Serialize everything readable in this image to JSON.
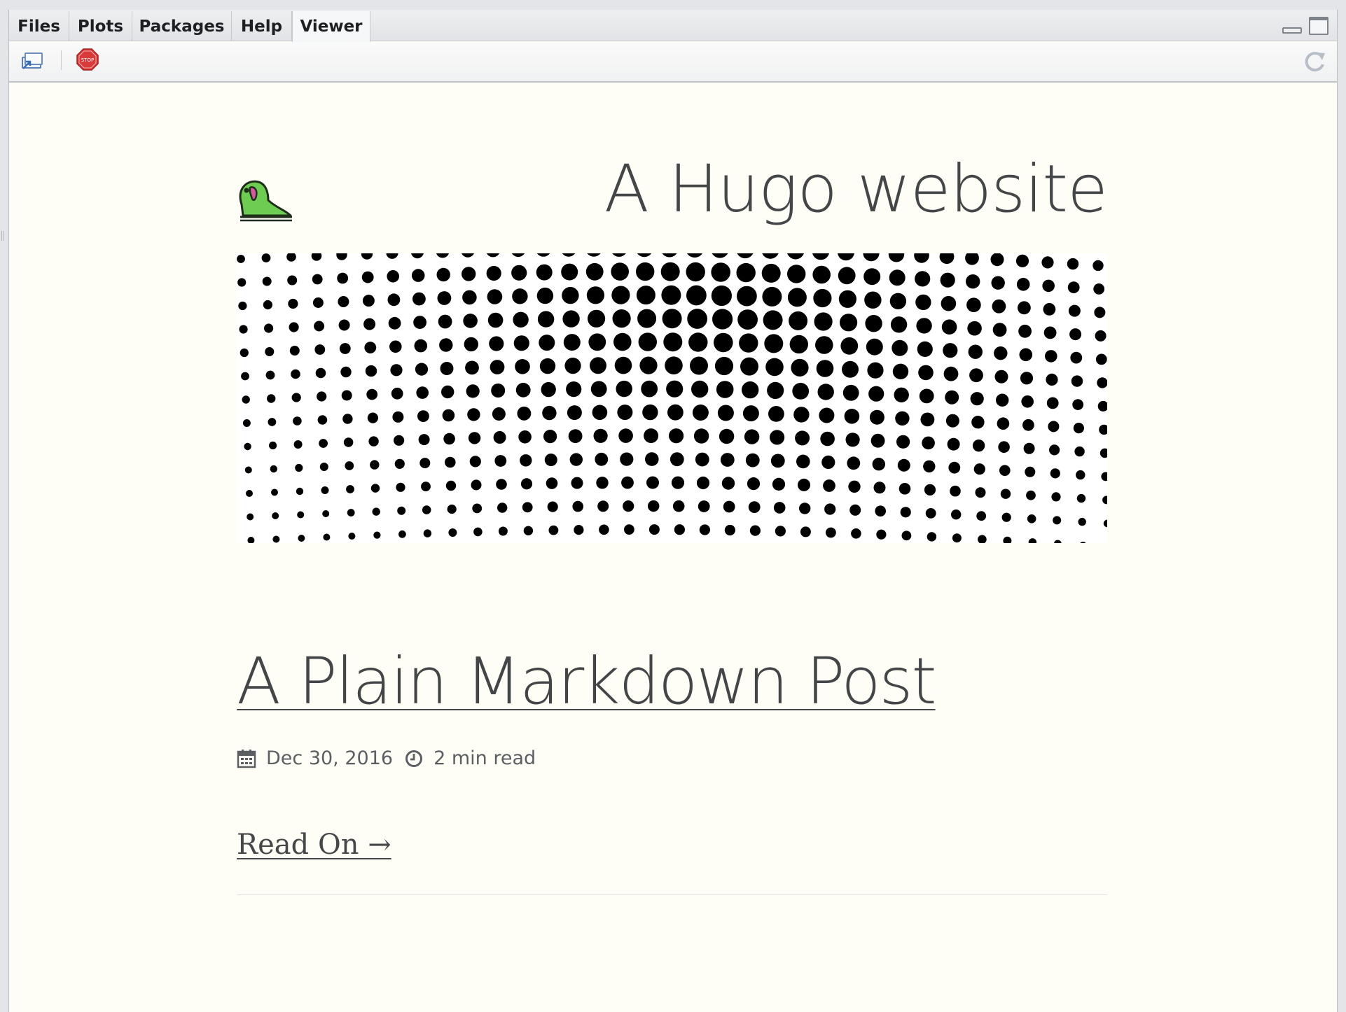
{
  "tabs": [
    {
      "label": "Files",
      "active": false
    },
    {
      "label": "Plots",
      "active": false
    },
    {
      "label": "Packages",
      "active": false
    },
    {
      "label": "Help",
      "active": false
    },
    {
      "label": "Viewer",
      "active": true
    }
  ],
  "toolbar": {
    "icons": [
      "export-to-browser-icon",
      "stop-icon",
      "refresh-icon"
    ],
    "stop_icon_text": "STOP"
  },
  "site": {
    "title": "A Hugo website",
    "logo_icon": "parrot-logo-icon",
    "banner_icon": "halftone-dot-banner"
  },
  "post": {
    "title": "A Plain Markdown Post",
    "date": "Dec 30, 2016",
    "reading_time": "2 min read",
    "read_on": "Read On →"
  },
  "colors": {
    "page_bg": "#fefef7",
    "text": "#444648",
    "parrot": "#6fcc52",
    "stop": "#d93a3a"
  }
}
